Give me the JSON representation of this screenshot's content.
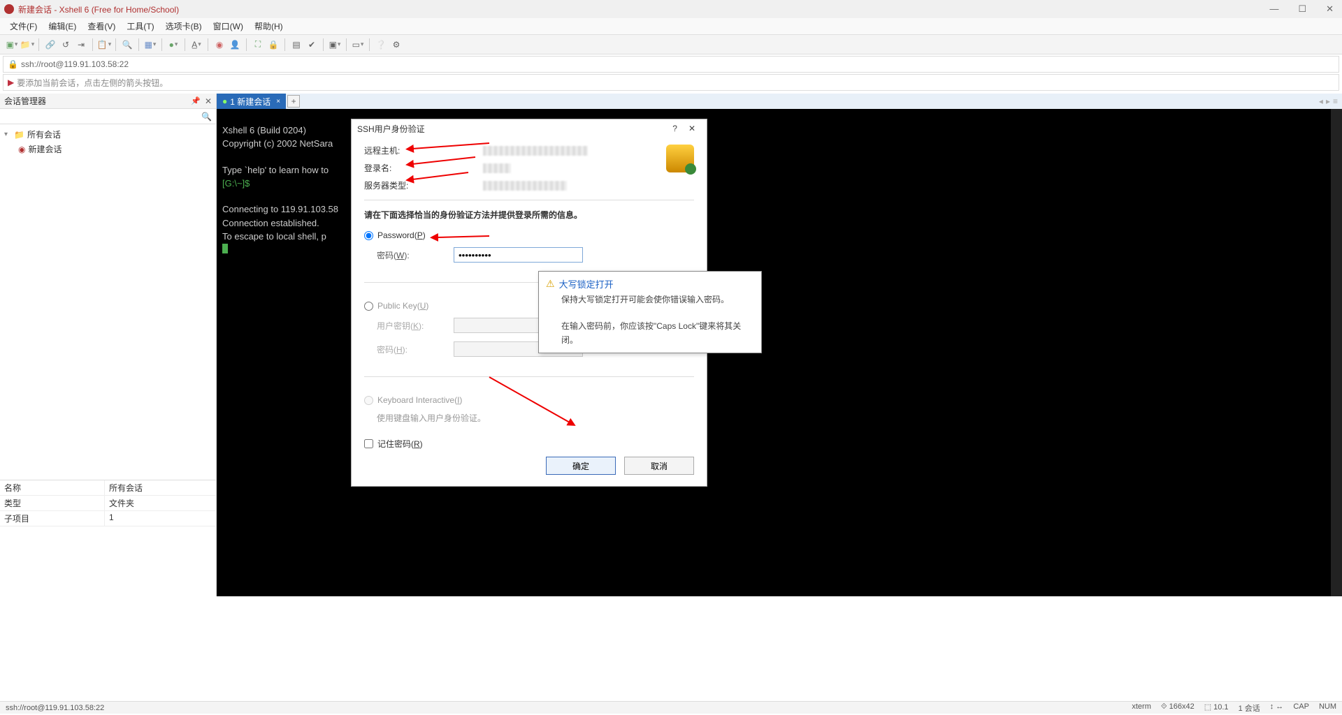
{
  "titlebar": {
    "title": "新建会话 - Xshell 6 (Free for Home/School)"
  },
  "menu": {
    "file": "文件(F)",
    "edit": "编辑(E)",
    "view": "查看(V)",
    "tools": "工具(T)",
    "tabs": "选项卡(B)",
    "window": "窗口(W)",
    "help": "帮助(H)"
  },
  "addr": "ssh://root@119.91.103.58:22",
  "hint": "要添加当前会话，点击左侧的箭头按钮。",
  "sessmgr": {
    "title": "会话管理器",
    "root": "所有会话",
    "child": "新建会话",
    "props": {
      "name": {
        "k": "名称",
        "v": "所有会话"
      },
      "type": {
        "k": "类型",
        "v": "文件夹"
      },
      "sub": {
        "k": "子项目",
        "v": "1"
      }
    }
  },
  "tab": {
    "label": "1 新建会话"
  },
  "terminal": {
    "l1": "Xshell 6 (Build 0204)",
    "l2": "Copyright (c) 2002 NetSara",
    "l3": "Type `help' to learn how to",
    "l4": "[G:\\~]$",
    "l5": "Connecting to 119.91.103.58",
    "l6": "Connection established.",
    "l7": "To escape to local shell, p"
  },
  "dialog": {
    "title": "SSH用户身份验证",
    "remote_host": "远程主机:",
    "login_name": "登录名:",
    "server_type": "服务器类型:",
    "instruction": "请在下面选择恰当的身份验证方法并提供登录所需的信息。",
    "password_radio": "Password(P)",
    "password_label": "密码(W):",
    "password_value": "●●●●●●●●●●",
    "pubkey_radio": "Public Key(U)",
    "userkey_label": "用户密钥(K):",
    "key_pwd_label": "密码(H):",
    "kbi_radio": "Keyboard Interactive(I)",
    "kbi_hint": "使用键盘输入用户身份验证。",
    "remember": "记住密码(R)",
    "ok": "确定",
    "cancel": "取消"
  },
  "tooltip": {
    "title": "大写锁定打开",
    "line1": "保持大写锁定打开可能会使你错误输入密码。",
    "line2": "在输入密码前，你应该按\"Caps Lock\"键来将其关闭。"
  },
  "status": {
    "left": "ssh://root@119.91.103.58:22",
    "term": "xterm",
    "size": "166x42",
    "zoom": "10.1",
    "sess": "1 会话",
    "cap": "CAP",
    "num": "NUM"
  }
}
